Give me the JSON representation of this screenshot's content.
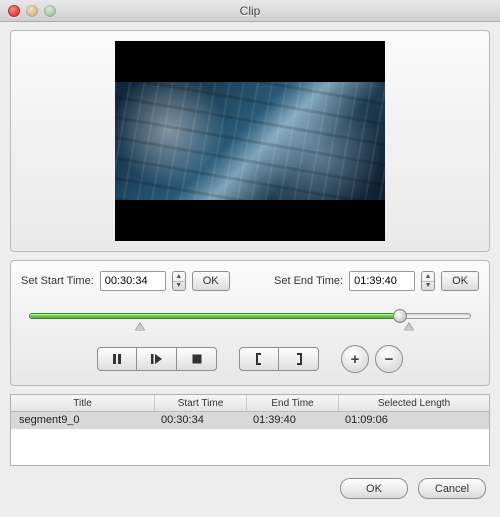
{
  "window": {
    "title": "Clip"
  },
  "time_controls": {
    "start_label": "Set Start Time:",
    "start_value": "00:30:34",
    "end_label": "Set End Time:",
    "end_value": "01:39:40",
    "ok_label": "OK"
  },
  "slider": {
    "fill_percent": 84,
    "knob_percent": 84,
    "range_start_percent": 25,
    "range_end_percent": 86
  },
  "transport_icons": {
    "pause": "pause-icon",
    "next": "next-frame-icon",
    "stop": "stop-icon",
    "mark_in": "mark-in-icon",
    "mark_out": "mark-out-icon",
    "plus": "+",
    "minus": "−"
  },
  "table": {
    "headers": {
      "title": "Title",
      "start": "Start Time",
      "end": "End Time",
      "length": "Selected Length"
    },
    "rows": [
      {
        "title": "segment9_0",
        "start": "00:30:34",
        "end": "01:39:40",
        "length": "01:09:06",
        "selected": true
      }
    ]
  },
  "footer": {
    "ok": "OK",
    "cancel": "Cancel"
  }
}
